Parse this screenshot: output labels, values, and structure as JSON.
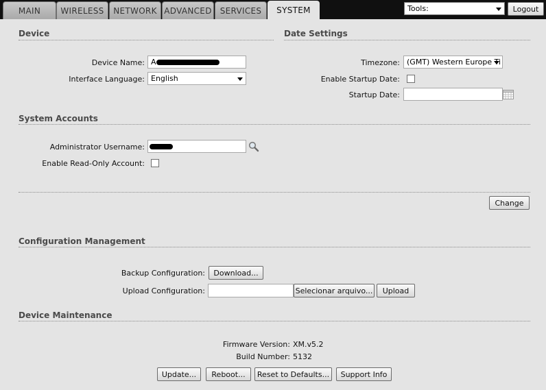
{
  "nav": {
    "tabs": [
      {
        "label": "MAIN"
      },
      {
        "label": "WIRELESS"
      },
      {
        "label": "NETWORK"
      },
      {
        "label": "ADVANCED"
      },
      {
        "label": "SERVICES"
      },
      {
        "label": "SYSTEM"
      }
    ],
    "active_tab": "SYSTEM",
    "tools_select": "Tools:",
    "logout_label": "Logout"
  },
  "device": {
    "title": "Device",
    "name_label": "Device Name:",
    "name_value_visible": "A",
    "language_label": "Interface Language:",
    "language_value": "English"
  },
  "date_settings": {
    "title": "Date Settings",
    "timezone_label": "Timezone:",
    "timezone_value": "(GMT) Western Europe Ti",
    "enable_startup_label": "Enable Startup Date:",
    "startup_date_label": "Startup Date:",
    "startup_date_value": ""
  },
  "accounts": {
    "title": "System Accounts",
    "admin_label": "Administrator Username:",
    "readonly_label": "Enable Read-Only Account:"
  },
  "change_label": "Change",
  "config": {
    "title": "Configuration Management",
    "backup_label": "Backup Configuration:",
    "download_label": "Download...",
    "upload_label": "Upload Configuration:",
    "choose_file_label": "Selecionar arquivo...",
    "upload_button_label": "Upload"
  },
  "maintenance": {
    "title": "Device Maintenance",
    "firmware_label": "Firmware Version:",
    "firmware_value": "XM.v5.2",
    "build_label": "Build Number:",
    "build_value": "5132",
    "update_label": "Update...",
    "reboot_label": "Reboot...",
    "reset_label": "Reset to Defaults...",
    "support_label": "Support Info"
  }
}
